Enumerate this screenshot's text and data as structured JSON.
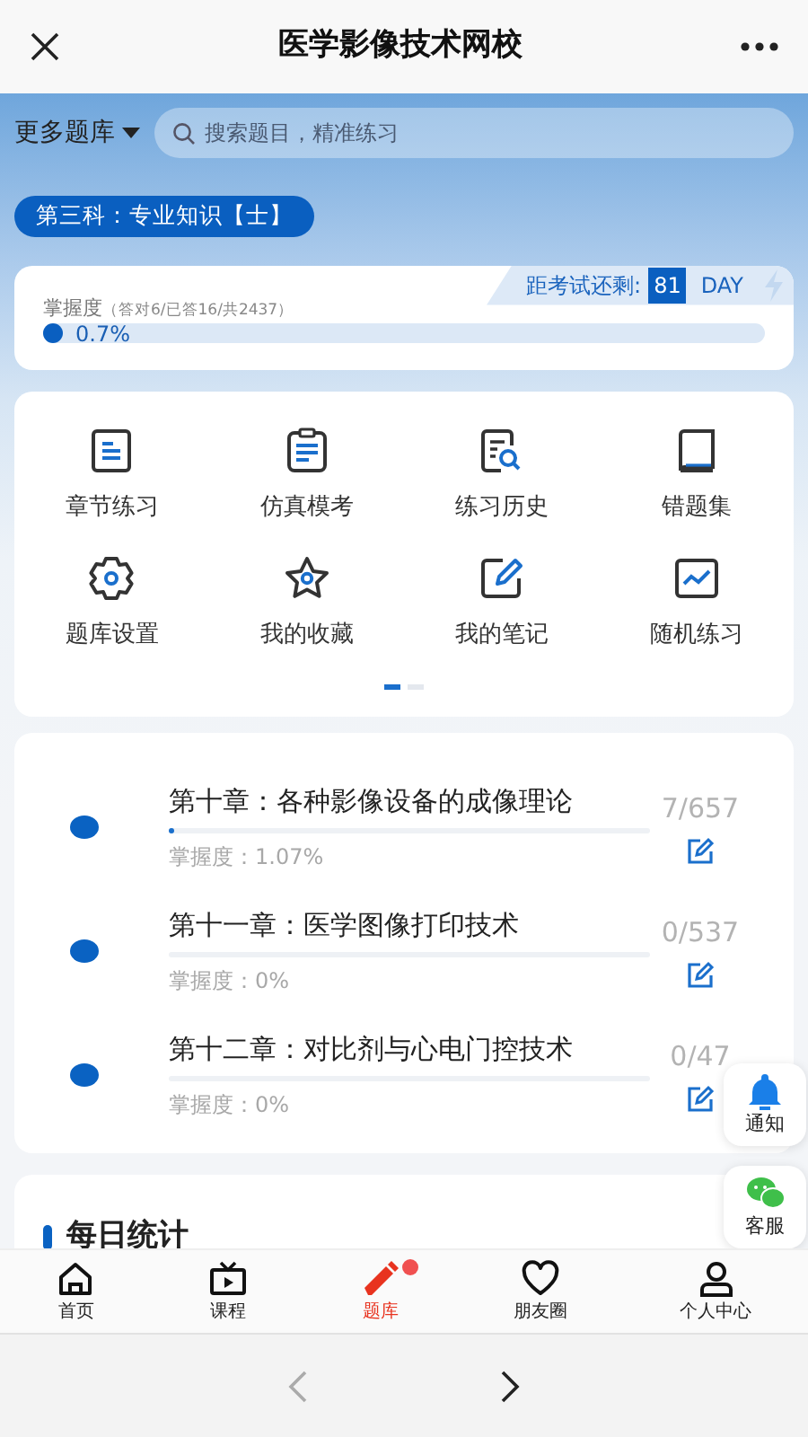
{
  "header": {
    "title": "医学影像技术网校"
  },
  "bank_menu": {
    "label": "更多题库"
  },
  "search": {
    "placeholder": "搜索题目，精准练习"
  },
  "subject": {
    "label": "第三科：专业知识【士】"
  },
  "progress": {
    "label": "掌握度",
    "detail": "（答对6/已答16/共2437）",
    "reading": "0.7%",
    "level": 0.007,
    "countdown_label": "距考试还剩:",
    "countdown_days": "81",
    "countdown_unit": "DAY"
  },
  "features": [
    {
      "kind": "doc",
      "label": "章节练习"
    },
    {
      "kind": "clipboard",
      "label": "仿真模考"
    },
    {
      "kind": "history",
      "label": "练习历史"
    },
    {
      "kind": "book",
      "label": "错题集"
    },
    {
      "kind": "gear",
      "label": "题库设置"
    },
    {
      "kind": "star",
      "label": "我的收藏"
    },
    {
      "kind": "note",
      "label": "我的笔记"
    },
    {
      "kind": "chart",
      "label": "随机练习"
    }
  ],
  "feature_pages": [
    {
      "selected": true
    },
    {
      "selected": false
    }
  ],
  "chapters": [
    {
      "title": "第十章：各种影像设备的成像理论",
      "mastery": "掌握度：1.07%",
      "level": 0.0107,
      "count": "7/657"
    },
    {
      "title": "第十一章：医学图像打印技术",
      "mastery": "掌握度：0%",
      "level": 0,
      "count": "0/537"
    },
    {
      "title": "第十二章：对比剂与心电门控技术",
      "mastery": "掌握度：0%",
      "level": 0,
      "count": "0/47"
    }
  ],
  "floating": [
    {
      "kind": "bell",
      "label": "通知"
    },
    {
      "kind": "chat",
      "label": "客服"
    }
  ],
  "daily_stats": {
    "title": "每日统计"
  },
  "tabs": [
    {
      "kind": "home",
      "label": "首页",
      "selected": false,
      "badge": false
    },
    {
      "kind": "tv",
      "label": "课程",
      "selected": false,
      "badge": false
    },
    {
      "kind": "pencil",
      "label": "题库",
      "selected": true,
      "badge": true
    },
    {
      "kind": "heart",
      "label": "朋友圈",
      "selected": false,
      "badge": false
    },
    {
      "kind": "person",
      "label": "个人中心",
      "selected": false,
      "badge": false
    }
  ],
  "browser_nav": {
    "back": {
      "disabled": true
    },
    "forward": {
      "disabled": false
    }
  }
}
